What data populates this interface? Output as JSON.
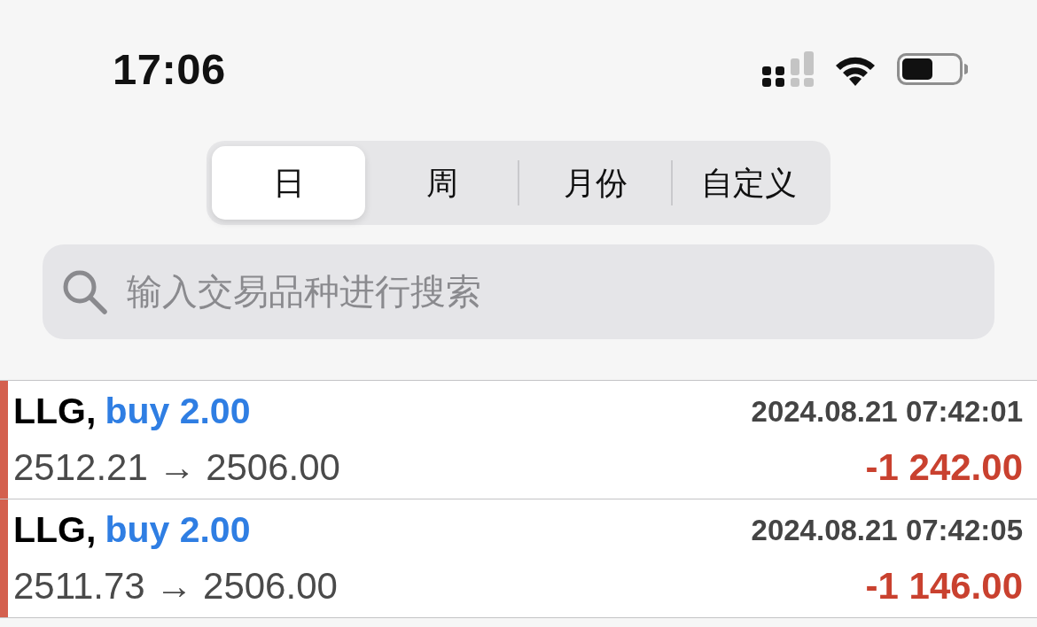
{
  "status_bar": {
    "time": "17:06"
  },
  "period_tabs": [
    {
      "label": "日",
      "selected": true
    },
    {
      "label": "周",
      "selected": false
    },
    {
      "label": "月份",
      "selected": false
    },
    {
      "label": "自定义",
      "selected": false
    }
  ],
  "search": {
    "placeholder": "输入交易品种进行搜索"
  },
  "trades": [
    {
      "symbol": "LLG,",
      "order": "buy 2.00",
      "time": "2024.08.21 07:42:01",
      "prices": "2512.21 → 2506.00",
      "profit": "-1 242.00",
      "color": "#d4604e"
    },
    {
      "symbol": "LLG,",
      "order": "buy 2.00",
      "time": "2024.08.21 07:42:05",
      "prices": "2511.73 → 2506.00",
      "profit": "-1 146.00",
      "color": "#d4604e"
    }
  ]
}
